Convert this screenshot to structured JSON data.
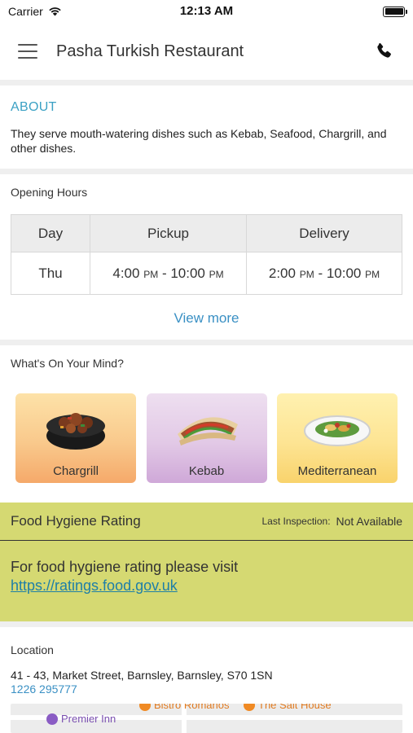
{
  "status_bar": {
    "carrier": "Carrier",
    "time": "12:13 AM"
  },
  "nav": {
    "title": "Pasha Turkish Restaurant"
  },
  "about": {
    "title": "ABOUT",
    "text": "They serve mouth-watering dishes such as Kebab, Seafood, Chargrill,  and other dishes."
  },
  "opening_hours": {
    "label": "Opening Hours",
    "headers": {
      "day": "Day",
      "pickup": "Pickup",
      "delivery": "Delivery"
    },
    "rows": [
      {
        "day": "Thu",
        "pickup": {
          "open": "4:00",
          "open_suffix": "PM",
          "sep": " - ",
          "close": "10:00",
          "close_suffix": "PM"
        },
        "delivery": {
          "open": "2:00",
          "open_suffix": "PM",
          "sep": " - ",
          "close": "10:00",
          "close_suffix": "PM"
        }
      }
    ],
    "view_more": "View more"
  },
  "whats_on_mind": {
    "label": "What's On Your Mind?",
    "categories": [
      {
        "label": "Chargrill",
        "icon": "chargrill-bowl-icon"
      },
      {
        "label": "Kebab",
        "icon": "kebab-wrap-icon"
      },
      {
        "label": "Mediterranean",
        "icon": "mediterranean-plate-icon"
      }
    ]
  },
  "hygiene": {
    "title": "Food Hygiene Rating",
    "inspection_label": "Last Inspection:",
    "inspection_value": "Not Available",
    "text": "For food hygiene rating please visit",
    "link": "https://ratings.food.gov.uk"
  },
  "location": {
    "label": "Location",
    "address": "41 - 43, Market Street, Barnsley, Barnsley, S70 1SN",
    "phone": "1226 295777"
  },
  "map": {
    "pois": [
      "Bistro Romanos",
      "The Salt House",
      "Premier Inn"
    ]
  },
  "colors": {
    "accent": "#3ba1c4",
    "hygiene_bg": "#d5d972",
    "link": "#1e7fa7"
  }
}
